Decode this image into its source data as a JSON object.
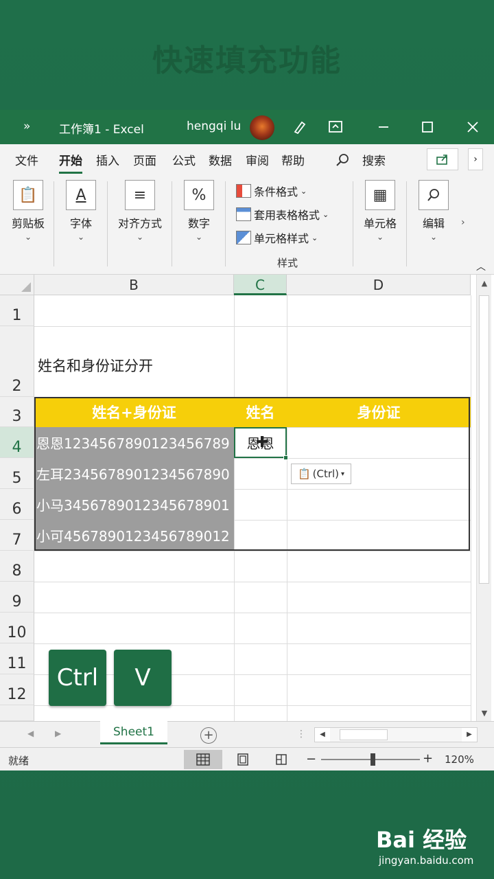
{
  "headline": "快速填充功能",
  "titlebar": {
    "chevron": "»",
    "workbook": "工作簿1  -  Excel",
    "user": "hengqi lu"
  },
  "tabs": [
    "文件",
    "开始",
    "插入",
    "页面",
    "公式",
    "数据",
    "审阅",
    "帮助"
  ],
  "active_tab": "开始",
  "search_label": "搜索",
  "ribbon": {
    "clipboard": "剪贴板",
    "font": "字体",
    "alignment": "对齐方式",
    "number": "数字",
    "conditional_format": "条件格式",
    "table_format": "套用表格格式",
    "cell_style": "单元格样式",
    "styles_group": "样式",
    "cells": "单元格",
    "editing": "编辑"
  },
  "columns": [
    "B",
    "C",
    "D"
  ],
  "rows": [
    "1",
    "2",
    "3",
    "4",
    "5",
    "6",
    "7",
    "8",
    "9",
    "10",
    "11",
    "12"
  ],
  "note_text": "姓名和身份证分开",
  "table": {
    "headers": [
      "姓名+身份证",
      "姓名",
      "身份证"
    ],
    "rows": [
      "恩恩123456789012345678​9",
      "左耳234567890123456789​0",
      "小马345678901234567890​1",
      "小可456789012345678901​2"
    ],
    "active_cell_value": "恩恩"
  },
  "paste_options": "(Ctrl)",
  "keys": [
    "Ctrl",
    "V"
  ],
  "sheet_tab": "Sheet1",
  "status": "就绪",
  "zoom": "120%",
  "watermark": {
    "brand": "Bai 经验",
    "url": "jingyan.baidu.com"
  }
}
